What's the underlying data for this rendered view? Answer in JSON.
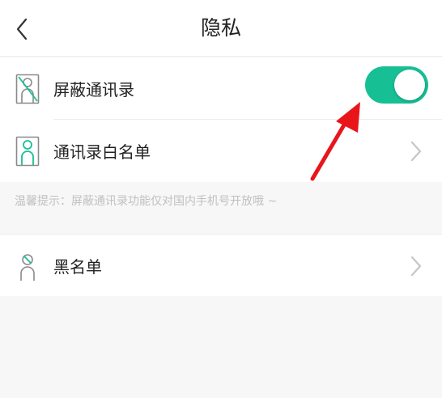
{
  "header": {
    "title": "隐私",
    "back_icon": "chevron-left-icon"
  },
  "settings": [
    {
      "label": "屏蔽通讯录",
      "icon": "contact-blocked-icon",
      "control": "toggle",
      "enabled": true
    },
    {
      "label": "通讯录白名单",
      "icon": "contact-whitelist-icon",
      "control": "chevron-right-icon"
    }
  ],
  "hint": "温馨提示：屏蔽通讯录功能仅对国内手机号开放哦 ~",
  "blacklist": {
    "label": "黑名单",
    "icon": "contact-banned-icon",
    "control": "chevron-right-icon"
  },
  "colors": {
    "accent": "#17bf95",
    "annotation_arrow": "#e8151b",
    "background": "#f7f7f7",
    "hint_text": "#c0c0c0",
    "icon_gray": "#8a8a8a"
  }
}
